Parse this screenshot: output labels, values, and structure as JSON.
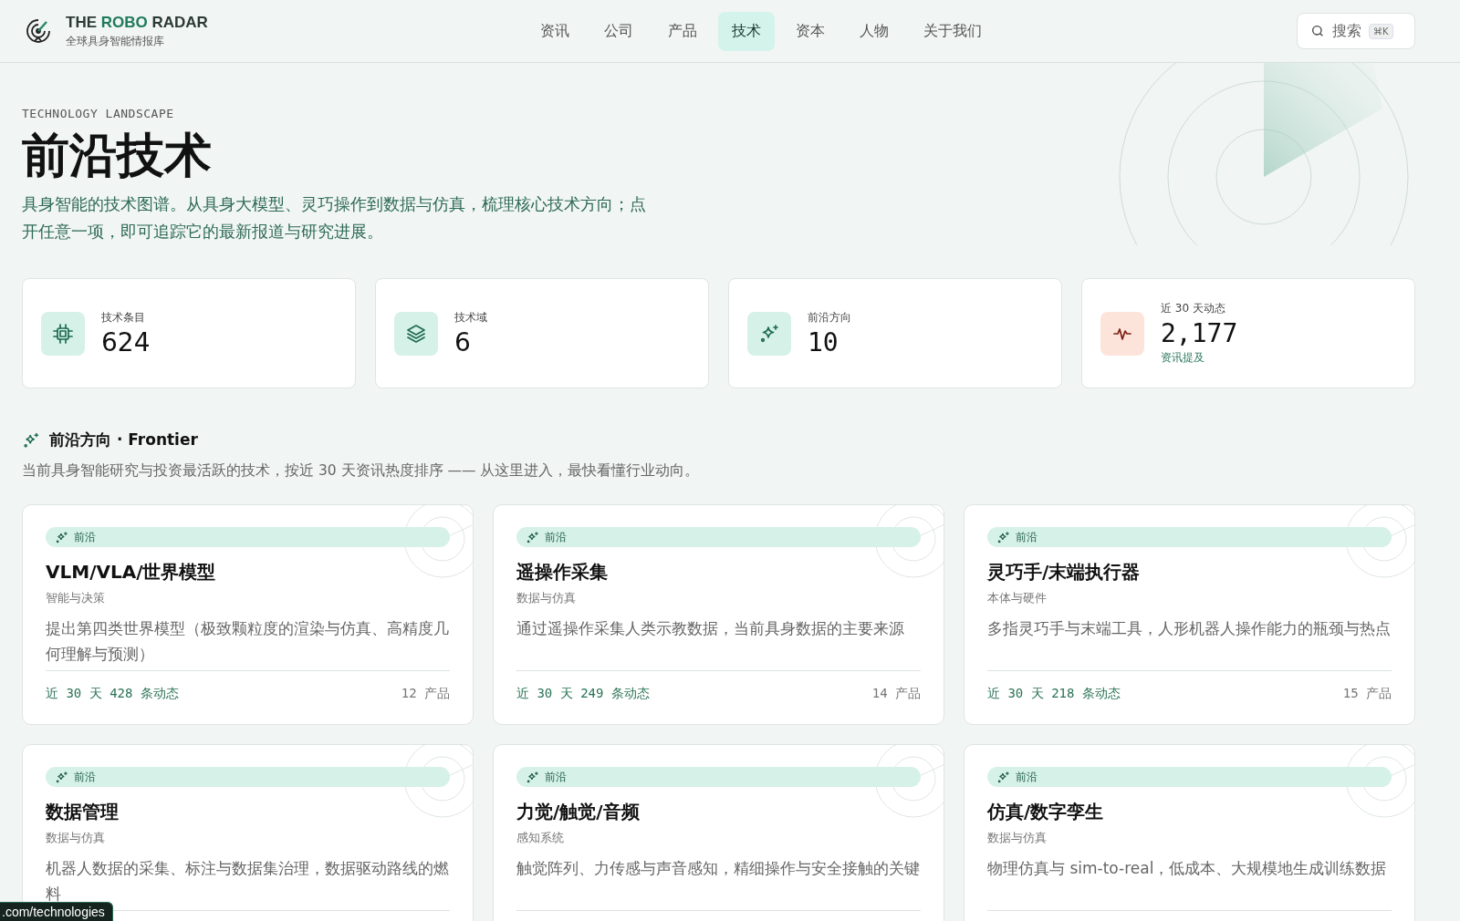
{
  "brand": {
    "name_start": "THE ",
    "name_accent": "ROBO",
    "name_end": " RADAR",
    "tagline": "全球具身智能情报库"
  },
  "nav": [
    {
      "label": "资讯",
      "selected": false
    },
    {
      "label": "公司",
      "selected": false
    },
    {
      "label": "产品",
      "selected": false
    },
    {
      "label": "技术",
      "selected": true
    },
    {
      "label": "资本",
      "selected": false
    },
    {
      "label": "人物",
      "selected": false
    },
    {
      "label": "关于我们",
      "selected": false
    }
  ],
  "search": {
    "placeholder": "搜索",
    "shortcut": "⌘K"
  },
  "hero": {
    "eyebrow": "TECHNOLOGY LANDSCAPE",
    "title": "前沿技术",
    "description": "具身智能的技术图谱。从具身大模型、灵巧操作到数据与仿真，梳理核心技术方向；点开任意一项，即可追踪它的最新报道与研究进展。"
  },
  "stats": [
    {
      "kind": "chip",
      "color": "#d5f1e8",
      "label": "技术条目",
      "value": "624",
      "mono": false
    },
    {
      "kind": "layers",
      "color": "#d5f1e8",
      "label": "技术域",
      "value": "6",
      "mono": false
    },
    {
      "kind": "sparkle",
      "color": "#d5f1e8",
      "label": "前沿方向",
      "value": "10",
      "mono": true
    },
    {
      "kind": "pulse",
      "color": "#fde4da",
      "label": "近 30 天动态",
      "value": "2,177",
      "mono": true,
      "note": "资讯提及"
    }
  ],
  "frontier": {
    "title": "前沿方向 · Frontier",
    "subtitle": "当前具身智能研究与投资最活跃的技术，按近 30 天资讯热度排序 —— 从这里进入，最快看懂行业动向。",
    "cards": [
      {
        "badge": "前沿",
        "title": "VLM/VLA/世界模型",
        "category": "智能与决策",
        "description": "提出第四类世界模型（极致颗粒度的渲染与仿真、高精度几何理解与预测）",
        "activity": "近 30 天 428 条动态",
        "products": "12 产品"
      },
      {
        "badge": "前沿",
        "title": "遥操作采集",
        "category": "数据与仿真",
        "description": "通过遥操作采集人类示教数据，当前具身数据的主要来源",
        "activity": "近 30 天 249 条动态",
        "products": "14 产品"
      },
      {
        "badge": "前沿",
        "title": "灵巧手/末端执行器",
        "category": "本体与硬件",
        "description": "多指灵巧手与末端工具，人形机器人操作能力的瓶颈与热点",
        "activity": "近 30 天 218 条动态",
        "products": "15 产品"
      },
      {
        "badge": "前沿",
        "title": "数据管理",
        "category": "数据与仿真",
        "description": "机器人数据的采集、标注与数据集治理，数据驱动路线的燃料"
      },
      {
        "badge": "前沿",
        "title": "力觉/触觉/音频",
        "category": "感知系统",
        "description": "触觉阵列、力传感与声音感知，精细操作与安全接触的关键"
      },
      {
        "badge": "前沿",
        "title": "仿真/数字孪生",
        "category": "数据与仿真",
        "description": "物理仿真与 sim-to-real，低成本、大规模地生成训练数据"
      }
    ]
  },
  "status_url": ".com/technologies"
}
